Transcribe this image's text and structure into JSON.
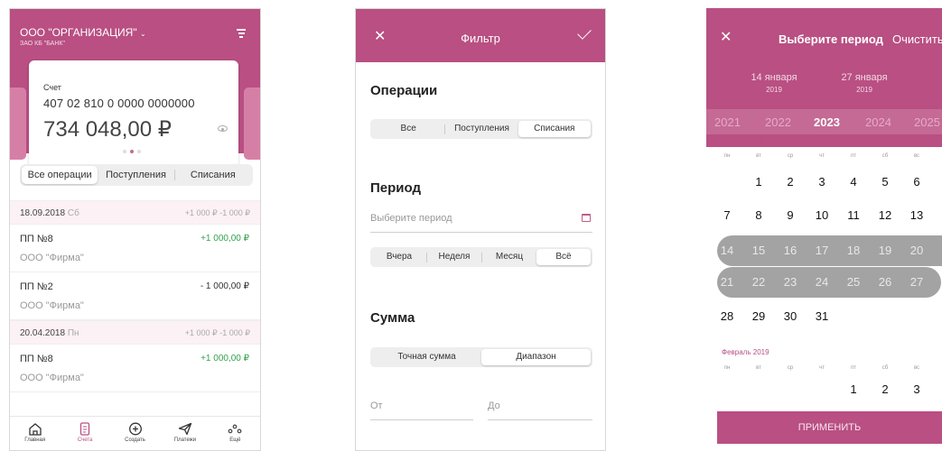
{
  "colors": {
    "accent": "#b94f82",
    "positive": "#35a24e",
    "range": "#a3a3a3"
  },
  "accounts": {
    "header": {
      "org": "ООО \"ОРГАНИЗАЦИЯ\"",
      "bank": "ЗАО КБ \"БАНК\""
    },
    "card": {
      "label": "Счет",
      "account": "407 02 810 0 0000 0000000",
      "balance": "734 048,00 ₽"
    },
    "tabs": [
      "Все операции",
      "Поступления",
      "Списания"
    ],
    "days": [
      {
        "date": "18.09.2018",
        "weekday": "Сб",
        "totals": "+1 000 ₽  -1 000 ₽",
        "ops": [
          {
            "name": "ПП №8",
            "counterparty": "ООО \"Фирма\"",
            "amount": "+1 000,00 ₽"
          },
          {
            "name": "ПП №2",
            "counterparty": "ООО \"Фирма\"",
            "amount": "- 1 000,00 ₽"
          }
        ]
      },
      {
        "date": "20.04.2018",
        "weekday": "Пн",
        "totals": "+1 000 ₽  -1 000 ₽",
        "ops": [
          {
            "name": "ПП №8",
            "counterparty": "ООО \"Фирма\"",
            "amount": "+1 000,00 ₽"
          }
        ]
      }
    ],
    "bottom_nav": [
      {
        "label": "Главная",
        "icon": "home-icon"
      },
      {
        "label": "Счета",
        "icon": "document-icon"
      },
      {
        "label": "Создать",
        "icon": "plus-circle-icon"
      },
      {
        "label": "Платежи",
        "icon": "paper-plane-icon"
      },
      {
        "label": "Ещё",
        "icon": "more-icon"
      }
    ]
  },
  "filter": {
    "title": "Фильтр",
    "operations": {
      "label": "Операции",
      "options": [
        "Все",
        "Поступления",
        "Списания"
      ]
    },
    "period": {
      "label": "Период",
      "placeholder": "Выберите период",
      "options": [
        "Вчера",
        "Неделя",
        "Месяц",
        "Всё"
      ]
    },
    "sum": {
      "label": "Сумма",
      "options": [
        "Точная сумма",
        "Диапазон"
      ],
      "from_placeholder": "От",
      "to_placeholder": "До"
    }
  },
  "period_picker": {
    "title": "Выберите период",
    "clear": "Очистить",
    "start": {
      "day": "14 января",
      "year": "2019"
    },
    "end": {
      "day": "27 января",
      "year": "2019"
    },
    "years": [
      "2021",
      "2022",
      "2023",
      "2024",
      "2025"
    ],
    "selected_year": "2023",
    "weekdays": [
      "пн",
      "вт",
      "ср",
      "чт",
      "пт",
      "сб",
      "вс"
    ],
    "january": {
      "label": "Январь  2019",
      "weeks": [
        [
          "",
          "1",
          "2",
          "3",
          "4",
          "5",
          "6"
        ],
        [
          "7",
          "8",
          "9",
          "10",
          "11",
          "12",
          "13"
        ],
        [
          "14",
          "15",
          "16",
          "17",
          "18",
          "19",
          "20"
        ],
        [
          "21",
          "22",
          "23",
          "24",
          "25",
          "26",
          "27"
        ],
        [
          "28",
          "29",
          "30",
          "31",
          "",
          "",
          ""
        ]
      ]
    },
    "february": {
      "label": "Февраль  2019",
      "weeks": [
        [
          "",
          "",
          "",
          "",
          "1",
          "2",
          "3"
        ]
      ]
    },
    "apply": "ПРИМЕНИТЬ"
  }
}
